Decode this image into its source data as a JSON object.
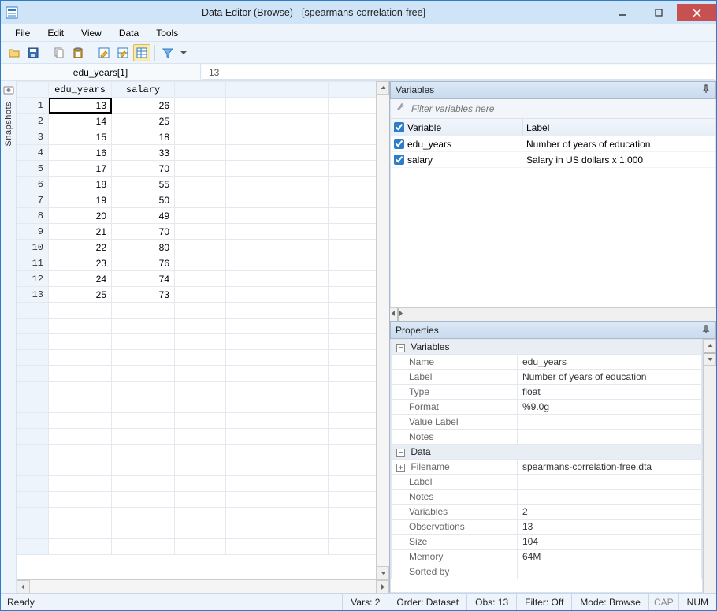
{
  "window": {
    "title": "Data Editor (Browse) - [spearmans-correlation-free]"
  },
  "menu": {
    "file": "File",
    "edit": "Edit",
    "view": "View",
    "data": "Data",
    "tools": "Tools"
  },
  "toolbar_icons": [
    "open",
    "save",
    "copy",
    "paste",
    "edit-row",
    "edit-cell",
    "browse",
    "filter",
    "dropdown"
  ],
  "cellref": {
    "name": "edu_years[1]",
    "value": "13"
  },
  "snapshots_label": "Snapshots",
  "grid": {
    "columns": [
      "edu_years",
      "salary"
    ],
    "rows": [
      {
        "n": 1,
        "vals": [
          "13",
          "26"
        ]
      },
      {
        "n": 2,
        "vals": [
          "14",
          "25"
        ]
      },
      {
        "n": 3,
        "vals": [
          "15",
          "18"
        ]
      },
      {
        "n": 4,
        "vals": [
          "16",
          "33"
        ]
      },
      {
        "n": 5,
        "vals": [
          "17",
          "70"
        ]
      },
      {
        "n": 6,
        "vals": [
          "18",
          "55"
        ]
      },
      {
        "n": 7,
        "vals": [
          "19",
          "50"
        ]
      },
      {
        "n": 8,
        "vals": [
          "20",
          "49"
        ]
      },
      {
        "n": 9,
        "vals": [
          "21",
          "70"
        ]
      },
      {
        "n": 10,
        "vals": [
          "22",
          "80"
        ]
      },
      {
        "n": 11,
        "vals": [
          "23",
          "76"
        ]
      },
      {
        "n": 12,
        "vals": [
          "24",
          "74"
        ]
      },
      {
        "n": 13,
        "vals": [
          "25",
          "73"
        ]
      }
    ],
    "empty_rows": 16,
    "selected": {
      "row": 0,
      "col": 0
    }
  },
  "vars_panel": {
    "title": "Variables",
    "filter_placeholder": "Filter variables here",
    "head_variable": "Variable",
    "head_label": "Label",
    "items": [
      {
        "name": "edu_years",
        "label": "Number of years of education"
      },
      {
        "name": "salary",
        "label": "Salary in US dollars x 1,000"
      }
    ]
  },
  "props_panel": {
    "title": "Properties",
    "variables_section": "Variables",
    "data_section": "Data",
    "variable": {
      "Name": "edu_years",
      "Label": "Number of years of education",
      "Type": "float",
      "Format": "%9.0g",
      "Value Label": "",
      "Notes": ""
    },
    "data": {
      "Filename": "spearmans-correlation-free.dta",
      "Label": "",
      "Notes": "",
      "Variables": "2",
      "Observations": "13",
      "Size": "104",
      "Memory": "64M",
      "Sorted by": ""
    }
  },
  "statusbar": {
    "ready": "Ready",
    "vars": "Vars: 2",
    "order": "Order: Dataset",
    "obs": "Obs: 13",
    "filter": "Filter: Off",
    "mode": "Mode: Browse",
    "cap": "CAP",
    "num": "NUM"
  }
}
